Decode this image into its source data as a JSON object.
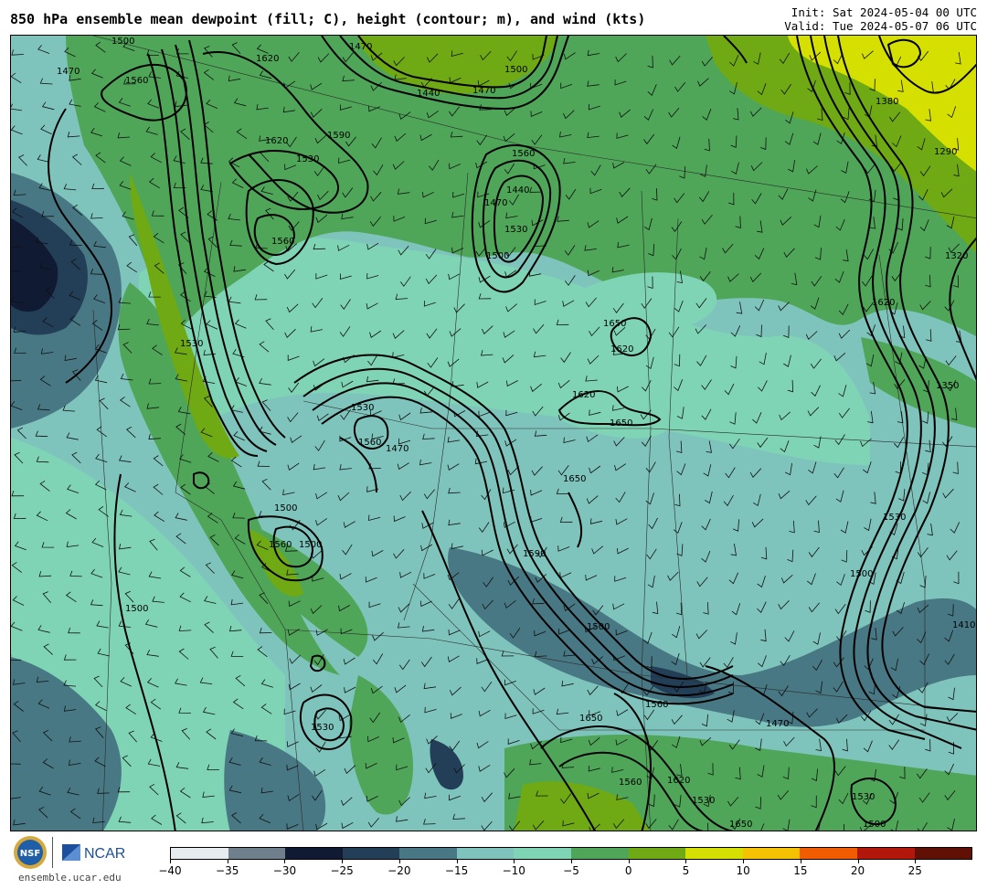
{
  "header": {
    "title": "850 hPa ensemble mean dewpoint (fill; C), height (contour; m), and wind (kts)",
    "init": "Init: Sat 2024-05-04 00 UTC",
    "valid": "Valid: Tue 2024-05-07 06 UTC"
  },
  "footer": {
    "website": "ensemble.ucar.edu",
    "ncar_text": "NCAR",
    "nsf_text": "NSF"
  },
  "colorbar": {
    "colors": [
      "#e6ebef",
      "#6f7f8b",
      "#101a33",
      "#233f57",
      "#487884",
      "#7fc4bc",
      "#80d4b6",
      "#4fa658",
      "#6faa14",
      "#d6e000",
      "#f5c200",
      "#f25c00",
      "#b3160a",
      "#611005"
    ],
    "ticks": [
      "−40",
      "−35",
      "−30",
      "−25",
      "−20",
      "−15",
      "−10",
      "−5",
      "0",
      "5",
      "10",
      "15",
      "20",
      "25"
    ]
  },
  "fill_colors": {
    "very_dry": "#101a33",
    "dry": "#233f57",
    "slate": "#487884",
    "teal": "#7fc4bc",
    "mint": "#80d4b6",
    "green": "#4fa658",
    "olive": "#6faa14",
    "yellow": "#d6e000"
  },
  "contour_labels": [
    "1560",
    "1620",
    "1470",
    "1500",
    "1590",
    "1530",
    "1620",
    "1560",
    "1440",
    "1470",
    "1530",
    "1560",
    "1500",
    "1500",
    "1650",
    "1620",
    "1620",
    "1650",
    "1530",
    "1560",
    "1470",
    "1650",
    "1500",
    "1560",
    "1500",
    "1470",
    "1530",
    "1440",
    "1470",
    "1410",
    "1650",
    "1560",
    "1530",
    "1620",
    "1350",
    "1290",
    "1380",
    "1320",
    "1500",
    "1530",
    "1590",
    "1500",
    "1470",
    "1500",
    "1530",
    "1650",
    "1560",
    "1620",
    "1530",
    "1500"
  ]
}
